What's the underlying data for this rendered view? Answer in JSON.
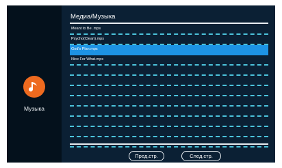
{
  "sidebar": {
    "icon": "music-note-icon",
    "label": "Музыка",
    "icon_color": "#ee6a1f"
  },
  "header": {
    "path": "Медиа/Музыка"
  },
  "files": [
    {
      "name": "Meant to Be .mps",
      "selected": false
    },
    {
      "name": "Psycho(Clean).mps",
      "selected": false
    },
    {
      "name": "God's Plan.mps",
      "selected": true
    },
    {
      "name": "Nice For What.mps",
      "selected": false
    },
    {
      "name": "",
      "selected": false
    },
    {
      "name": "",
      "selected": false
    },
    {
      "name": "",
      "selected": false
    },
    {
      "name": "",
      "selected": false
    },
    {
      "name": "",
      "selected": false
    },
    {
      "name": "",
      "selected": false
    },
    {
      "name": "",
      "selected": false
    },
    {
      "name": "",
      "selected": false
    }
  ],
  "buttons": {
    "prev": "Пред.стр.",
    "next": "След.стр."
  },
  "colors": {
    "accent": "#1d93e4",
    "divider": "#4cc4dc"
  }
}
